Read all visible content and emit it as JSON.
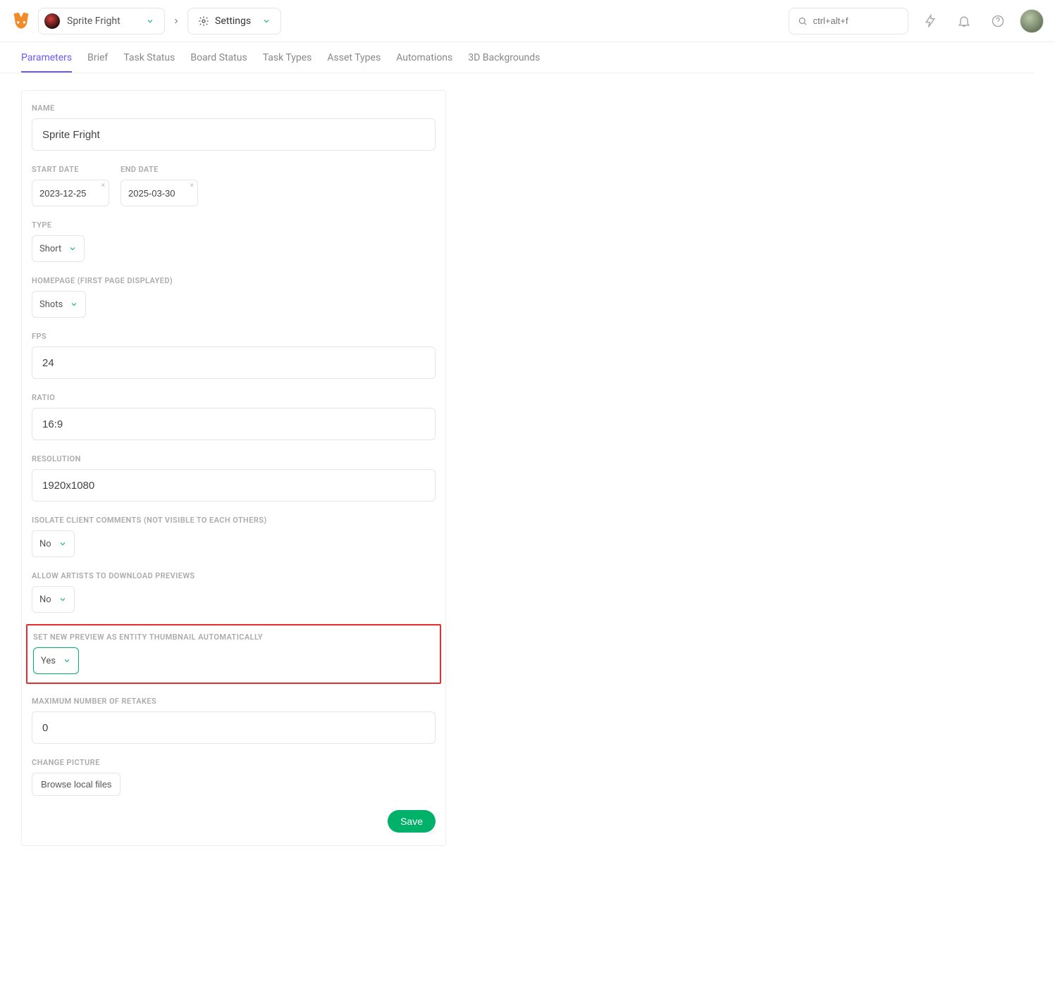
{
  "header": {
    "project_name": "Sprite Fright",
    "section_label": "Settings",
    "search_placeholder": "ctrl+alt+f"
  },
  "tabs": [
    {
      "label": "Parameters",
      "active": true
    },
    {
      "label": "Brief"
    },
    {
      "label": "Task Status"
    },
    {
      "label": "Board Status"
    },
    {
      "label": "Task Types"
    },
    {
      "label": "Asset Types"
    },
    {
      "label": "Automations"
    },
    {
      "label": "3D Backgrounds"
    }
  ],
  "form": {
    "name_label": "Name",
    "name_value": "Sprite Fright",
    "start_date_label": "Start Date",
    "start_date_value": "2023-12-25",
    "end_date_label": "End Date",
    "end_date_value": "2025-03-30",
    "type_label": "Type",
    "type_value": "Short",
    "homepage_label": "Homepage (first page displayed)",
    "homepage_value": "Shots",
    "fps_label": "FPS",
    "fps_value": "24",
    "ratio_label": "Ratio",
    "ratio_value": "16:9",
    "resolution_label": "Resolution",
    "resolution_value": "1920x1080",
    "isolate_label": "Isolate client comments (not visible to each others)",
    "isolate_value": "No",
    "allow_download_label": "Allow artists to download previews",
    "allow_download_value": "No",
    "auto_thumb_label": "Set new preview as entity thumbnail automatically",
    "auto_thumb_value": "Yes",
    "max_retakes_label": "Maximum number of retakes",
    "max_retakes_value": "0",
    "change_picture_label": "Change Picture",
    "browse_label": "Browse local files",
    "save_label": "Save"
  }
}
